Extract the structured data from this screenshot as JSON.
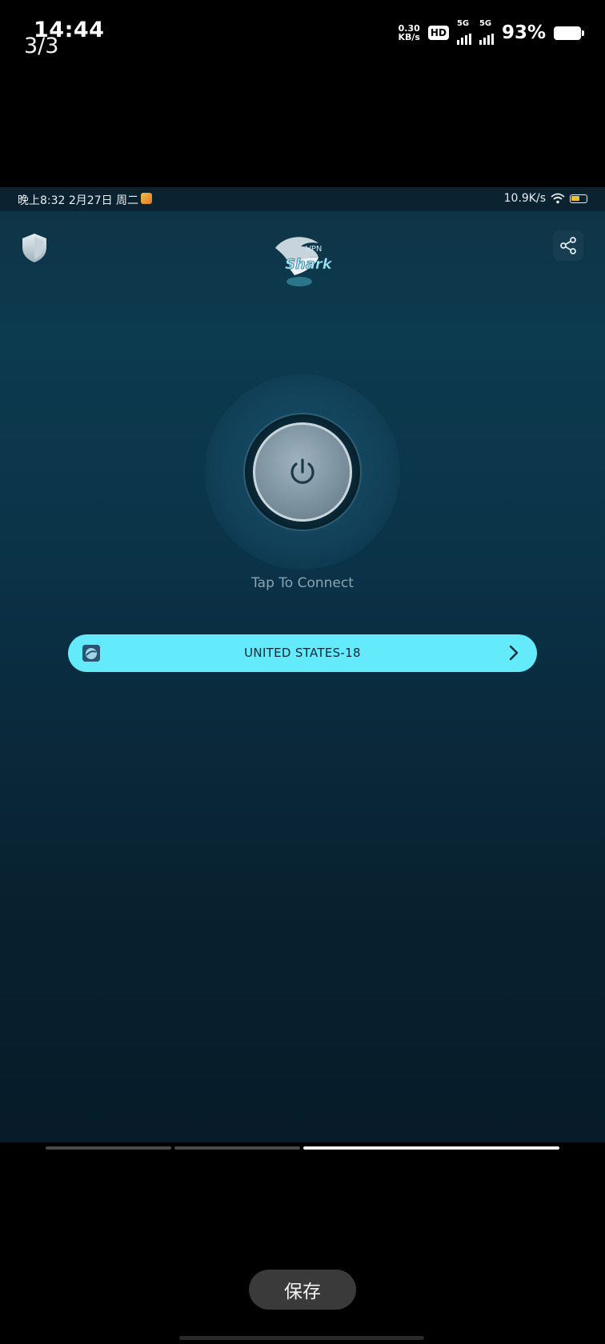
{
  "outer_status_bar": {
    "time": "14:44",
    "net_speed_value": "0.30",
    "net_speed_unit": "KB/s",
    "hd_badge": "HD",
    "sim1_label": "5G",
    "sim2_label": "5G",
    "battery_percent": "93%"
  },
  "gallery": {
    "page_indicator": "3/3",
    "current_index": 2,
    "total": 3,
    "save_label": "保存"
  },
  "inner_status_bar": {
    "datetime": "晚上8:32 2月27日 周二",
    "net_speed": "10.9K/s",
    "battery_level": 0.6
  },
  "app": {
    "logo_text_top": "VPN",
    "logo_text_main": "Shark",
    "tap_to_connect": "Tap To Connect",
    "server": {
      "name": "UNITED STATES-18"
    }
  },
  "colors": {
    "accent": "#63eafb",
    "background_top": "#0f3345",
    "background_bottom": "#071b28",
    "power_button": "#8aa0ad"
  },
  "icons": {
    "top_left": "shield-icon",
    "top_right": "share-icon",
    "center": "power-icon",
    "server_chevron": "chevron-right-icon"
  }
}
